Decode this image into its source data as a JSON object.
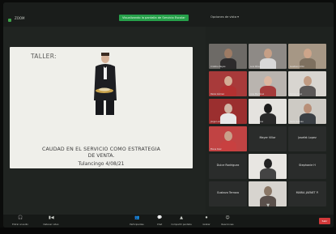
{
  "window": {
    "app_title": "ZOOM",
    "notice": "Visualizando la pantalla de Servicio Escolar",
    "view_options": "Opciones de vista ▾"
  },
  "slide": {
    "heading": "TALLER:",
    "line1": "CAUDAD EN EL SERVICIO COMO ESTRATEGIA",
    "line2": "DE VENTA.",
    "line3": "Tulancingo 4/08/21"
  },
  "participants": [
    {
      "name": "Cristina Reyes",
      "style": "video",
      "bg": "#6d6a66",
      "skin": "#9d7b64",
      "shirt": "#2d2b2c"
    },
    {
      "name": "Luis Pérez",
      "style": "video",
      "bg": "#8e8a86",
      "skin": "#c59f86",
      "shirt": "#d8d8d8"
    },
    {
      "name": "Gustavo Ortiz",
      "style": "video",
      "bg": "#a69785",
      "skin": "#cda58a",
      "shirt": "#7e705f"
    },
    {
      "name": "Paola Gómez",
      "style": "video",
      "bg": "#a83a3a",
      "skin": "#d4ad95",
      "shirt": "#b33131"
    },
    {
      "name": "Ana Martínez",
      "style": "video",
      "bg": "#b9b4af",
      "skin": "#dcb6a0",
      "shirt": "#a53b3b"
    },
    {
      "name": "Rubén Cruz",
      "style": "video",
      "bg": "#d8d5d0",
      "skin": "#c19b82",
      "shirt": "#5b5857"
    },
    {
      "name": "Jorge Luna",
      "style": "video",
      "bg": "#9b2f2f",
      "skin": "#d0b4a4",
      "shirt": "#e8e8e8"
    },
    {
      "name": "Diana Flores",
      "style": "video",
      "bg": "#e5e3df",
      "skin": "#1b1b1b",
      "shirt": "#2a2a2a"
    },
    {
      "name": "Karla Salinas",
      "style": "video",
      "bg": "#cdcac4",
      "skin": "#b88f78",
      "shirt": "#3a3f44"
    },
    {
      "name": "Elena Ruiz",
      "style": "video",
      "bg": "#c14343",
      "skin": "#c9a08a",
      "shirt": "#c84040"
    },
    {
      "name": "Mayer Villar",
      "style": "name"
    },
    {
      "name": "Josefat Lopez",
      "style": "name"
    },
    {
      "name": "Dulce Rodriguez",
      "style": "name"
    },
    {
      "name": "",
      "style": "video",
      "bg": "#e8e6e2",
      "skin": "#222222",
      "shirt": "#444444"
    },
    {
      "name": "Stephanie H",
      "style": "name"
    },
    {
      "name": "Gustavo Terrazo",
      "style": "name"
    },
    {
      "name": "",
      "style": "video",
      "bg": "#d7d4cf",
      "skin": "#8a7766",
      "shirt": "#5a504b"
    },
    {
      "name": "MARIA JAENET P.",
      "style": "name"
    }
  ],
  "toolbar": {
    "items": [
      {
        "label": "Entrar al audio",
        "icon": "🎧"
      },
      {
        "label": "Detener video",
        "icon": "▮◀"
      },
      {
        "label": "Participantes",
        "icon": "👥"
      },
      {
        "label": "Chat",
        "icon": "💬"
      },
      {
        "label": "Compartir pantalla",
        "icon": "▲"
      },
      {
        "label": "Grabar",
        "icon": "⏺"
      },
      {
        "label": "Reacciones",
        "icon": "☺"
      }
    ],
    "leave": "Salir"
  },
  "colors": {
    "accent": "#26a04a",
    "leave": "#d2393a"
  }
}
